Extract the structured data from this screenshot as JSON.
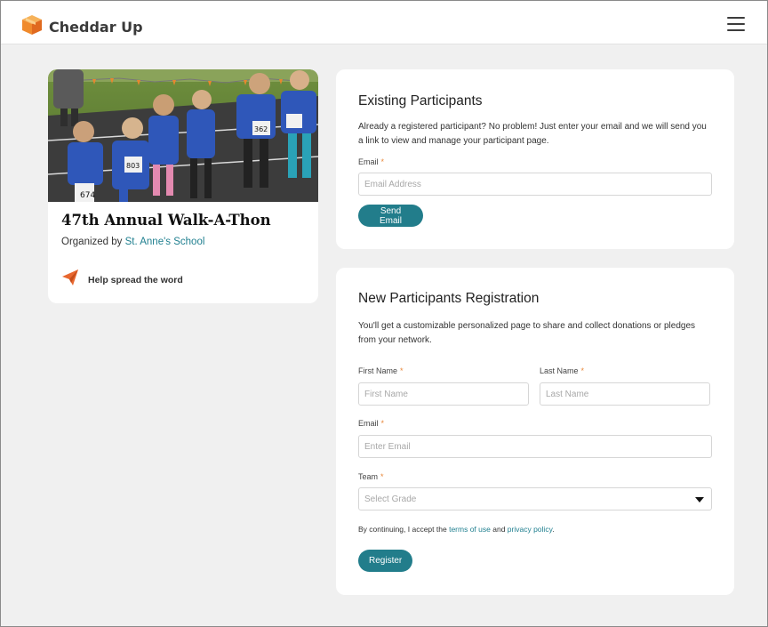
{
  "header": {
    "brand_name": "Cheddar Up",
    "logo_icon": "cheddar-up-cube-logo",
    "menu_icon": "hamburger-menu-icon",
    "brand_color": "#f09a3e"
  },
  "event": {
    "title": "47th Annual Walk-A-Thon",
    "organized_by_prefix": "Organized by",
    "organizer_name": "St. Anne's School",
    "share_label": "Help spread the word",
    "share_icon": "paper-plane-icon",
    "photo": "children in blue t-shirts with race bibs at a walk-a-thon"
  },
  "existing": {
    "heading": "Existing Participants",
    "description": "Already a registered participant? No problem! Just enter your email and we will send you a link to view and manage your participant page.",
    "email_label": "Email",
    "required_mark": "*",
    "email_placeholder": "Email Address",
    "submit_label": "Send Email"
  },
  "new_registration": {
    "heading": "New Participants Registration",
    "description": "You'll get a customizable personalized page to share and collect donations or pledges from your network.",
    "first_name_label": "First Name",
    "first_name_placeholder": "First Name",
    "last_name_label": "Last Name",
    "last_name_placeholder": "Last Name",
    "email_label": "Email",
    "email_placeholder": "Enter Email",
    "team_label": "Team",
    "team_selected": "Select Grade",
    "required_mark": "*",
    "terms_prefix": "By continuing, I accept the",
    "terms_link": "terms of use",
    "terms_and": "and",
    "privacy_link": "privacy policy",
    "terms_suffix": ".",
    "submit_label": "Register"
  },
  "colors": {
    "accent": "#227d8b",
    "link": "#1f7f8f",
    "required": "#e8873a",
    "page_background": "#f0f0f0"
  }
}
